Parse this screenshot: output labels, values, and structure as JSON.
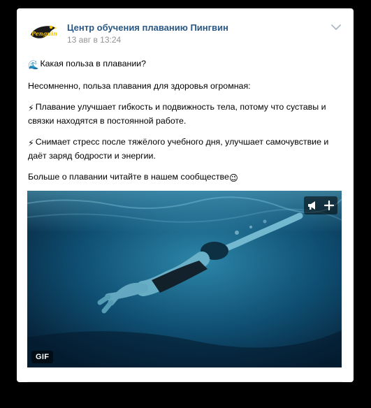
{
  "post": {
    "group_name": "Центр обучения плаванию Пингвин",
    "date": "13 авг в 13:24",
    "avatar_text": "Penguin",
    "lines": {
      "question": "Какая польза в плавании?",
      "intro": "Несомненно, польза плавания для здоровья огромная:",
      "benefit1": "Плавание улучшает гибкость и подвижность тела, потому что суставы и связки находятся в постоянной работе.",
      "benefit2": "Снимает стресс после тяжёлого учебного дня, улучшает самочувствие и даёт заряд бодрости и энергии.",
      "outro": "Больше о плавании читайте в нашем сообществе"
    },
    "emojis": {
      "wave": "🌊",
      "bolt": "⚡",
      "wink": "😉"
    },
    "media": {
      "badge": "GIF",
      "description_icons": [
        "megaphone-icon",
        "plus-icon"
      ]
    }
  },
  "colors": {
    "link": "#2a5885",
    "muted": "#939393",
    "background": "#000000",
    "card": "#ffffff",
    "water": "#0a3a57"
  }
}
